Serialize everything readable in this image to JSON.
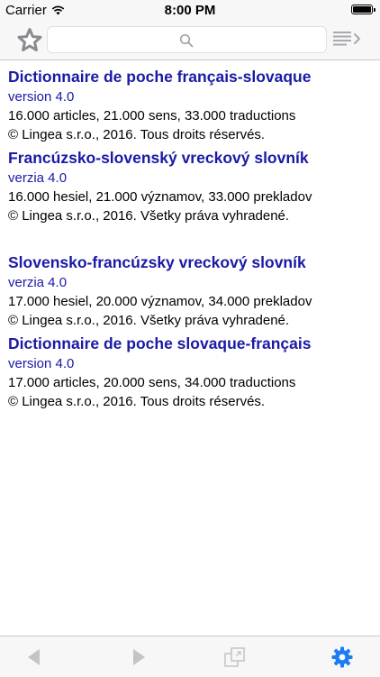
{
  "status_bar": {
    "carrier": "Carrier",
    "time": "8:00 PM"
  },
  "toolbar": {
    "search_value": "",
    "search_placeholder": ""
  },
  "dictionaries": [
    {
      "title": "Dictionnaire de poche français-slovaque",
      "version": "version 4.0",
      "stats": "16.000 articles, 21.000 sens, 33.000 traductions",
      "copyright": "© Lingea s.r.o., 2016. Tous droits réservés."
    },
    {
      "title": "Francúzsko-slovenský vreckový slovník",
      "version": "verzia 4.0",
      "stats": "16.000 hesiel, 21.000 významov, 33.000 prekladov",
      "copyright": "© Lingea s.r.o., 2016. Všetky práva vyhradené."
    },
    {
      "title": "Slovensko-francúzsky vreckový slovník",
      "version": "verzia 4.0",
      "stats": "17.000 hesiel, 20.000 významov, 34.000 prekladov",
      "copyright": "© Lingea s.r.o., 2016. Všetky práva vyhradené."
    },
    {
      "title": "Dictionnaire de poche slovaque-français",
      "version": "version 4.0",
      "stats": "17.000 articles, 20.000 sens, 34.000 traductions",
      "copyright": "© Lingea s.r.o., 2016. Tous droits réservés."
    }
  ],
  "icons": {
    "favorites": "star-icon",
    "search": "magnifier-icon",
    "list": "list-arrow-icon",
    "back": "triangle-left-icon",
    "forward": "triangle-right-icon",
    "window": "windows-icon",
    "settings": "gear-icon"
  },
  "colors": {
    "link_blue": "#1a1aa6",
    "accent_blue": "#1c7cf4",
    "bar_background": "#f7f7f7"
  }
}
